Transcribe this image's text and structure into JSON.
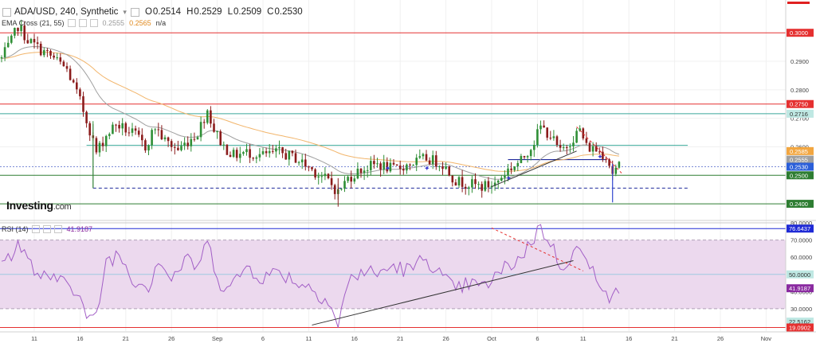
{
  "header": {
    "symbol": "ADA/USD, 240, Synthetic",
    "open_label": "O",
    "open": "0.2514",
    "high_label": "H",
    "high": "0.2529",
    "low_label": "L",
    "low": "0.2509",
    "close_label": "C",
    "close": "0.2530"
  },
  "ema_legend": {
    "label": "EMA Cross (21, 55)",
    "v1": "0.2555",
    "v2": "0.2565",
    "v3": "n/a"
  },
  "rsi_legend": {
    "label": "RSI (14)",
    "value": "41.9187"
  },
  "brand": {
    "name": "Investing",
    "domain": ".com"
  },
  "colors": {
    "up": "#2f8f36",
    "down": "#8b1c1c",
    "ema_fast": "#a0a0a0",
    "ema_slow": "#f2b56b",
    "rsi_line": "#a25fc6",
    "rsi_band": "#ecd9ee",
    "red_line": "#e53030",
    "green_line": "#2e7d32",
    "teal_line": "#3aa89a",
    "navy": "#1f2a9c",
    "blue_line": "#1f2ad6"
  },
  "chart_data": [
    {
      "type": "candlestick",
      "title": "ADA/USD, 240, Synthetic",
      "ylim": [
        0.235,
        0.3115
      ],
      "y_ticks": [
        0.28,
        0.29,
        0.2,
        0.26
      ],
      "y_tick_labels": [
        "0.2800",
        "0.2900",
        "0.2700",
        "0.2600"
      ],
      "x_tick_labels": [
        "11",
        "16",
        "21",
        "26",
        "Sep",
        "6",
        "11",
        "16",
        "21",
        "26",
        "Oct",
        "6",
        "11",
        "16",
        "21",
        "26",
        "Nov"
      ],
      "price_anchors": [
        {
          "i": 0,
          "p": 0.291
        },
        {
          "i": 3,
          "p": 0.297
        },
        {
          "i": 5,
          "p": 0.3025
        },
        {
          "i": 8,
          "p": 0.2975
        },
        {
          "i": 12,
          "p": 0.294
        },
        {
          "i": 16,
          "p": 0.291
        },
        {
          "i": 20,
          "p": 0.287
        },
        {
          "i": 24,
          "p": 0.276
        },
        {
          "i": 27,
          "p": 0.266
        },
        {
          "i": 29,
          "p": 0.258
        },
        {
          "i": 32,
          "p": 0.264
        },
        {
          "i": 35,
          "p": 0.268
        },
        {
          "i": 38,
          "p": 0.266
        },
        {
          "i": 41,
          "p": 0.264
        },
        {
          "i": 44,
          "p": 0.26
        },
        {
          "i": 47,
          "p": 0.267
        },
        {
          "i": 50,
          "p": 0.262
        },
        {
          "i": 54,
          "p": 0.259
        },
        {
          "i": 57,
          "p": 0.262
        },
        {
          "i": 60,
          "p": 0.265
        },
        {
          "i": 63,
          "p": 0.273
        },
        {
          "i": 65,
          "p": 0.266
        },
        {
          "i": 68,
          "p": 0.26
        },
        {
          "i": 71,
          "p": 0.257
        },
        {
          "i": 75,
          "p": 0.258
        },
        {
          "i": 80,
          "p": 0.257
        },
        {
          "i": 85,
          "p": 0.258
        },
        {
          "i": 90,
          "p": 0.256
        },
        {
          "i": 95,
          "p": 0.252
        },
        {
          "i": 100,
          "p": 0.248
        },
        {
          "i": 103,
          "p": 0.244
        },
        {
          "i": 106,
          "p": 0.249
        },
        {
          "i": 110,
          "p": 0.252
        },
        {
          "i": 115,
          "p": 0.254
        },
        {
          "i": 120,
          "p": 0.252
        },
        {
          "i": 125,
          "p": 0.254
        },
        {
          "i": 130,
          "p": 0.256
        },
        {
          "i": 135,
          "p": 0.254
        },
        {
          "i": 139,
          "p": 0.248
        },
        {
          "i": 143,
          "p": 0.247
        },
        {
          "i": 147,
          "p": 0.246
        },
        {
          "i": 151,
          "p": 0.247
        },
        {
          "i": 155,
          "p": 0.252
        },
        {
          "i": 159,
          "p": 0.255
        },
        {
          "i": 163,
          "p": 0.262
        },
        {
          "i": 165,
          "p": 0.267
        },
        {
          "i": 168,
          "p": 0.264
        },
        {
          "i": 171,
          "p": 0.258
        },
        {
          "i": 174,
          "p": 0.262
        },
        {
          "i": 177,
          "p": 0.266
        },
        {
          "i": 179,
          "p": 0.26
        },
        {
          "i": 182,
          "p": 0.259
        },
        {
          "i": 185,
          "p": 0.257
        },
        {
          "i": 187,
          "p": 0.251
        },
        {
          "i": 189,
          "p": 0.253
        }
      ],
      "x_range_bars": [
        0,
        265
      ],
      "price_levels": [
        {
          "price": 0.3,
          "label": "0.3000",
          "color": "#e53030",
          "box": "#e53030"
        },
        {
          "price": 0.275,
          "label": "0.2750",
          "color": "#e53030",
          "box": "#e53030"
        },
        {
          "price": 0.2716,
          "label": "0.2716",
          "color": "#3aa89a",
          "box": "#bfe8e3",
          "text": "#333"
        },
        {
          "price": 0.2585,
          "label": "0.2585",
          "color": "#f2b56b",
          "box": "#f2a640"
        },
        {
          "price": 0.2555,
          "label": "0.2555",
          "color": "#a0a0a0",
          "box": "#a0a0a0"
        },
        {
          "price": 0.253,
          "label": "0.2530",
          "color": "#1f2ad6",
          "box": "#2b5fd9"
        },
        {
          "price": 0.25,
          "label": "0.2500",
          "color": "#2e7d32",
          "box": "#2e7d32"
        },
        {
          "price": 0.24,
          "label": "0.2400",
          "color": "#2e7d32",
          "box": "#2e7d32"
        }
      ]
    },
    {
      "type": "line",
      "title": "RSI (14)",
      "ylim": [
        17,
        80
      ],
      "y_tick_labels": [
        "80.0000",
        "70.0000",
        "60.0000",
        "50.0000",
        "40.0000",
        "30.0000"
      ],
      "levels": [
        {
          "value": 76.6437,
          "label": "76.6437",
          "box": "#1f2ad6"
        },
        {
          "value": 50.0,
          "label": "50.0000",
          "box": "#bfe8e3",
          "text": "#333"
        },
        {
          "value": 41.9187,
          "label": "41.9187",
          "box": "#8a2aa0"
        },
        {
          "value": 22.5162,
          "label": "22.5162",
          "box": "#bfe8e3",
          "text": "#333"
        },
        {
          "value": 19.0902,
          "label": "19.0902",
          "box": "#e53030"
        }
      ],
      "band": [
        30,
        70
      ],
      "rsi_anchors": [
        {
          "i": 0,
          "v": 55
        },
        {
          "i": 5,
          "v": 68
        },
        {
          "i": 10,
          "v": 52
        },
        {
          "i": 15,
          "v": 45
        },
        {
          "i": 20,
          "v": 50
        },
        {
          "i": 24,
          "v": 35
        },
        {
          "i": 27,
          "v": 22
        },
        {
          "i": 29,
          "v": 25
        },
        {
          "i": 32,
          "v": 58
        },
        {
          "i": 36,
          "v": 62
        },
        {
          "i": 40,
          "v": 48
        },
        {
          "i": 45,
          "v": 43
        },
        {
          "i": 48,
          "v": 60
        },
        {
          "i": 52,
          "v": 47
        },
        {
          "i": 56,
          "v": 58
        },
        {
          "i": 60,
          "v": 55
        },
        {
          "i": 63,
          "v": 68
        },
        {
          "i": 67,
          "v": 45
        },
        {
          "i": 70,
          "v": 42
        },
        {
          "i": 75,
          "v": 55
        },
        {
          "i": 80,
          "v": 48
        },
        {
          "i": 85,
          "v": 52
        },
        {
          "i": 90,
          "v": 46
        },
        {
          "i": 95,
          "v": 42
        },
        {
          "i": 100,
          "v": 35
        },
        {
          "i": 103,
          "v": 20
        },
        {
          "i": 106,
          "v": 45
        },
        {
          "i": 110,
          "v": 52
        },
        {
          "i": 115,
          "v": 50
        },
        {
          "i": 120,
          "v": 55
        },
        {
          "i": 125,
          "v": 52
        },
        {
          "i": 130,
          "v": 60
        },
        {
          "i": 135,
          "v": 48
        },
        {
          "i": 139,
          "v": 40
        },
        {
          "i": 143,
          "v": 45
        },
        {
          "i": 147,
          "v": 42
        },
        {
          "i": 151,
          "v": 48
        },
        {
          "i": 155,
          "v": 55
        },
        {
          "i": 159,
          "v": 60
        },
        {
          "i": 163,
          "v": 72
        },
        {
          "i": 165,
          "v": 78
        },
        {
          "i": 168,
          "v": 68
        },
        {
          "i": 171,
          "v": 55
        },
        {
          "i": 174,
          "v": 60
        },
        {
          "i": 177,
          "v": 66
        },
        {
          "i": 179,
          "v": 55
        },
        {
          "i": 182,
          "v": 50
        },
        {
          "i": 185,
          "v": 42
        },
        {
          "i": 187,
          "v": 34
        },
        {
          "i": 189,
          "v": 41.9
        }
      ]
    }
  ]
}
